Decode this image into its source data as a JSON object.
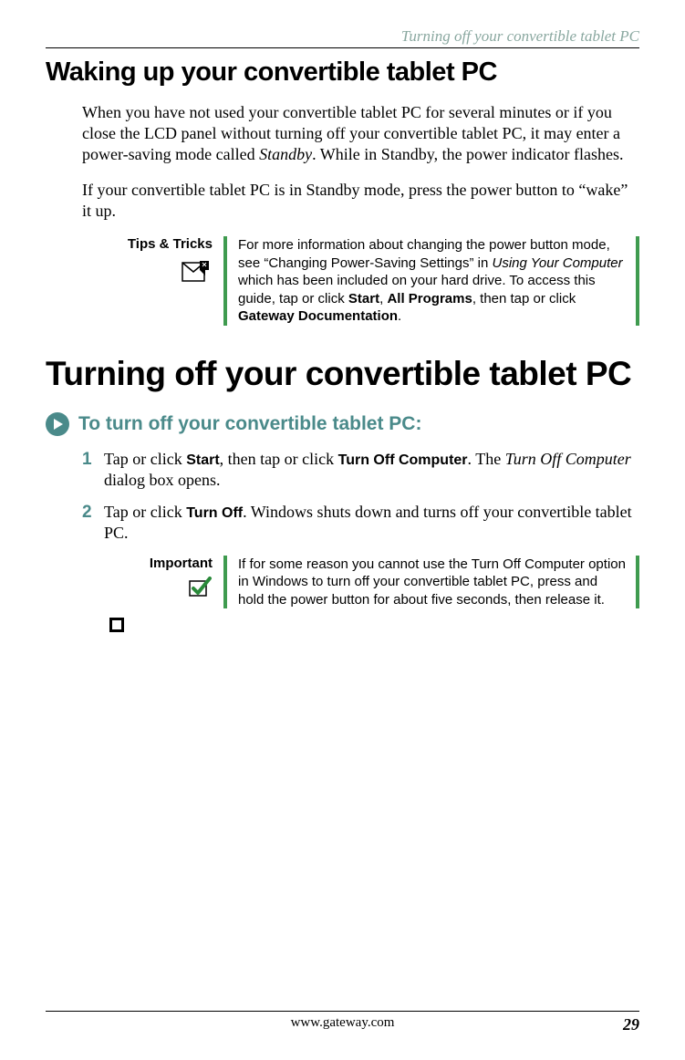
{
  "running_header": "Turning off your convertible tablet PC",
  "section1": {
    "title": "Waking up your convertible tablet PC",
    "p1_a": "When you have not used your convertible tablet PC for several minutes or if you close the LCD panel without turning off your convertible tablet PC, it may enter a power-saving mode called ",
    "p1_b": "Standby",
    "p1_c": ". While in Standby, the power indicator flashes.",
    "p2": "If your convertible tablet PC is in Standby mode, press the power button to “wake” it up."
  },
  "tips": {
    "label": "Tips & Tricks",
    "text_a": "For more information about changing the power button mode, see “Changing Power-Saving Settings” in ",
    "text_b": "Using Your Computer",
    "text_c": " which has been included on your hard drive. To access this guide, tap or click ",
    "text_d": "Start",
    "text_e": ", ",
    "text_f": "All Programs",
    "text_g": ", then tap or click ",
    "text_h": "Gateway Documentation",
    "text_i": "."
  },
  "section2": {
    "title": "Turning off your convertible tablet PC",
    "howto": "To turn off your convertible tablet PC:",
    "step1": {
      "num": "1",
      "a": "Tap or click ",
      "b": "Start",
      "c": ", then tap or click ",
      "d": "Turn Off Computer",
      "e": ". The ",
      "f": "Turn Off Computer",
      "g": " dialog box opens."
    },
    "step2": {
      "num": "2",
      "a": "Tap or click ",
      "b": "Turn Off",
      "c": ". Windows shuts down and turns off your convertible tablet PC."
    }
  },
  "important": {
    "label": "Important",
    "text": "If for some reason you cannot use the Turn Off Computer option in Windows to turn off your convertible tablet PC, press and hold the power button for about five seconds, then release it."
  },
  "footer": {
    "url": "www.gateway.com",
    "page": "29"
  }
}
